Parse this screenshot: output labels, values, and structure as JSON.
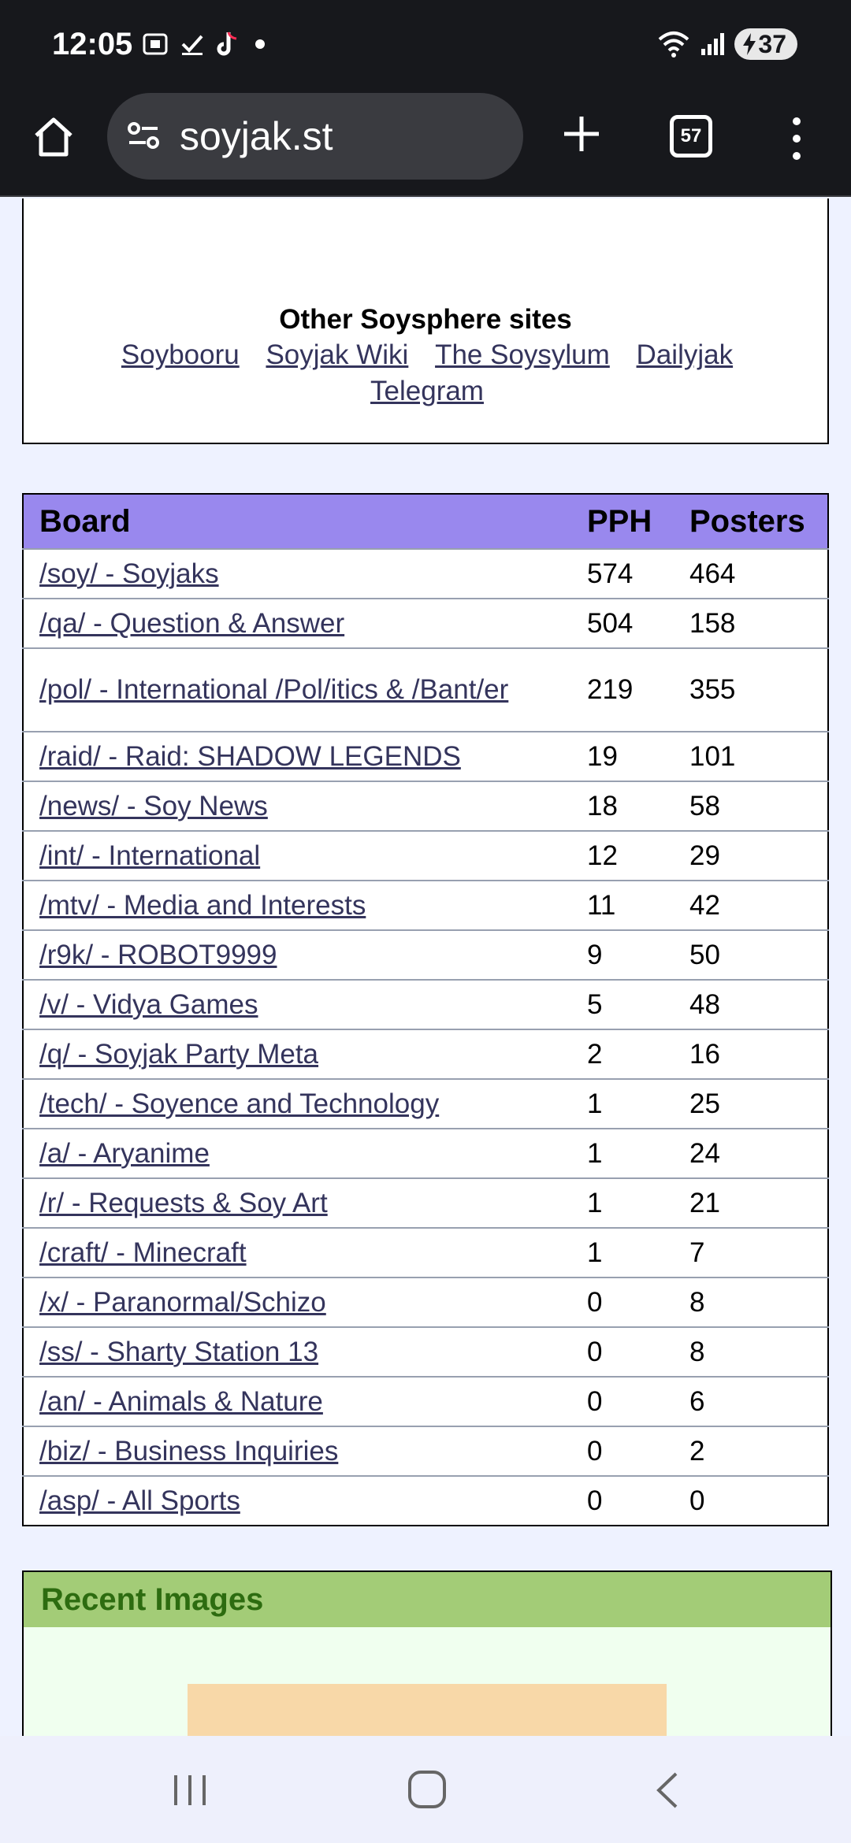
{
  "status": {
    "time": "12:05",
    "battery": "37"
  },
  "browser": {
    "url": "soyjak.st",
    "tab_count": "57"
  },
  "sites": {
    "title": "Other Soysphere sites",
    "links": [
      "Soybooru",
      "Soyjak Wiki",
      "The Soysylum",
      "Dailyjak",
      "Telegram"
    ]
  },
  "boards": {
    "headers": {
      "board": "Board",
      "pph": "PPH",
      "posters": "Posters"
    },
    "rows": [
      {
        "board": "/soy/ - Soyjaks",
        "pph": "574",
        "posters": "464"
      },
      {
        "board": "/qa/ - Question & Answer",
        "pph": "504",
        "posters": "158"
      },
      {
        "board": "/pol/ - International /Pol/itics & /Bant/er",
        "pph": "219",
        "posters": "355"
      },
      {
        "board": "/raid/ - Raid: SHADOW LEGENDS",
        "pph": "19",
        "posters": "101"
      },
      {
        "board": "/news/ - Soy News",
        "pph": "18",
        "posters": "58"
      },
      {
        "board": "/int/ - International",
        "pph": "12",
        "posters": "29"
      },
      {
        "board": "/mtv/ - Media and Interests",
        "pph": "11",
        "posters": "42"
      },
      {
        "board": "/r9k/ - ROBOT9999",
        "pph": "9",
        "posters": "50"
      },
      {
        "board": "/v/ - Vidya Games",
        "pph": "5",
        "posters": "48"
      },
      {
        "board": "/q/ - Soyjak Party Meta",
        "pph": "2",
        "posters": "16"
      },
      {
        "board": "/tech/ - Soyence and Technology",
        "pph": "1",
        "posters": "25"
      },
      {
        "board": "/a/ - Aryanime",
        "pph": "1",
        "posters": "24"
      },
      {
        "board": "/r/ - Requests & Soy Art",
        "pph": "1",
        "posters": "21"
      },
      {
        "board": "/craft/ - Minecraft",
        "pph": "1",
        "posters": "7"
      },
      {
        "board": "/x/ - Paranormal/Schizo",
        "pph": "0",
        "posters": "8"
      },
      {
        "board": "/ss/ - Sharty Station 13",
        "pph": "0",
        "posters": "8"
      },
      {
        "board": "/an/ - Animals & Nature",
        "pph": "0",
        "posters": "6"
      },
      {
        "board": "/biz/ - Business Inquiries",
        "pph": "0",
        "posters": "2"
      },
      {
        "board": "/asp/ - All Sports",
        "pph": "0",
        "posters": "0"
      }
    ]
  },
  "recent_images": {
    "title": "Recent Images"
  },
  "colors": {
    "header_bar": "#17181c",
    "table_header": "#9988ee",
    "link": "#34345c",
    "recent_header": "#a3cc77",
    "recent_title": "#2d6c10"
  }
}
